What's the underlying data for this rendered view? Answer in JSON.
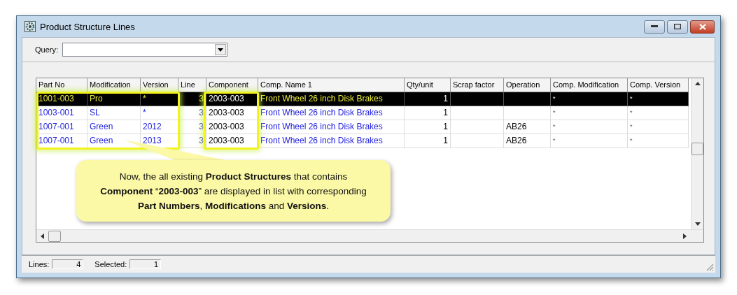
{
  "window": {
    "title": "Product Structure Lines"
  },
  "query": {
    "label": "Query:"
  },
  "table": {
    "columns": [
      {
        "label": "Part No",
        "kind": "link"
      },
      {
        "label": "Modification",
        "kind": "link"
      },
      {
        "label": "Version",
        "kind": "link"
      },
      {
        "label": "Line",
        "kind": "link_number"
      },
      {
        "label": "Component",
        "kind": "plain"
      },
      {
        "label": "Comp. Name 1",
        "kind": "link"
      },
      {
        "label": "Qty/unit",
        "kind": "number"
      },
      {
        "label": "Scrap factor",
        "kind": "plain"
      },
      {
        "label": "Operation",
        "kind": "plain"
      },
      {
        "label": "Comp. Modification",
        "kind": "small"
      },
      {
        "label": "Comp. Version",
        "kind": "small"
      }
    ],
    "rows": [
      {
        "selected": true,
        "cells": [
          "1001-003",
          "Pro",
          "*",
          "3",
          "2003-003",
          "Front Wheel 26 inch Disk Brakes",
          "1",
          "",
          "",
          "*",
          "*"
        ]
      },
      {
        "selected": false,
        "cells": [
          "1003-001",
          "SL",
          "*",
          "3",
          "2003-003",
          "Front Wheel 26 inch Disk Brakes",
          "1",
          "",
          "",
          "*",
          "*"
        ]
      },
      {
        "selected": false,
        "cells": [
          "1007-001",
          "Green",
          "2012",
          "3",
          "2003-003",
          "Front Wheel 26 inch Disk Brakes",
          "1",
          "",
          "AB26",
          "*",
          "*"
        ]
      },
      {
        "selected": false,
        "cells": [
          "1007-001",
          "Green",
          "2013",
          "3",
          "2003-003",
          "Front Wheel 26 inch Disk Brakes",
          "1",
          "",
          "AB26",
          "*",
          "*"
        ]
      }
    ]
  },
  "callout": {
    "text": "Now, the all existing **Product Structures** that contains **Component**  “**2003-003**” are displayed in list with corresponding **Part Numbers**, **Modifications**  and **Versions**."
  },
  "status_bar": {
    "lines_label": "Lines:",
    "lines": "4",
    "selected_label": "Selected:",
    "selected": "1"
  }
}
